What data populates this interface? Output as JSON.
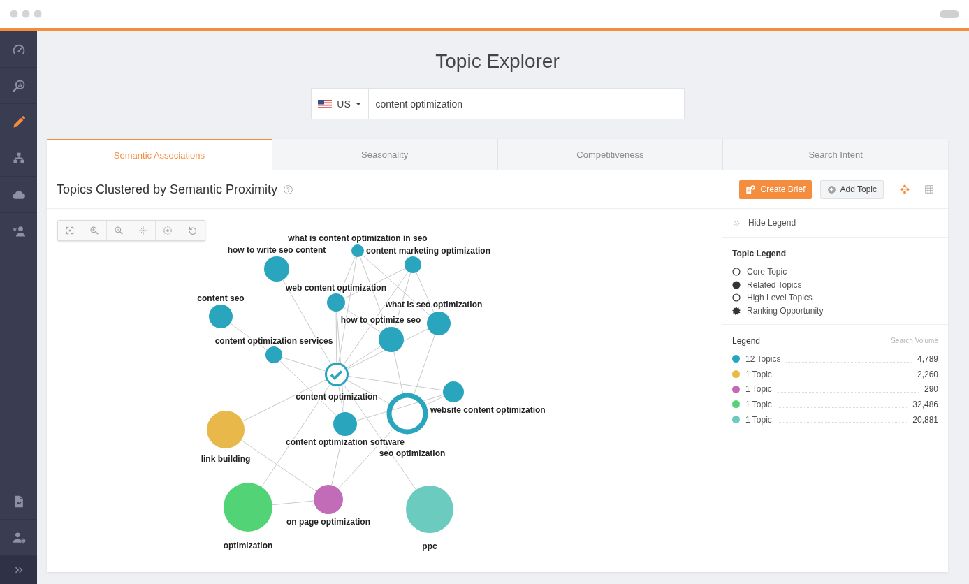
{
  "app": {
    "title": "Topic Explorer"
  },
  "sidebar": {
    "items": [
      {
        "selected": false
      },
      {
        "selected": false
      },
      {
        "selected": true
      },
      {
        "selected": false
      },
      {
        "selected": false
      },
      {
        "selected": false
      }
    ]
  },
  "search": {
    "country": "US",
    "value": "content optimization"
  },
  "tabs": [
    {
      "label": "Semantic Associations",
      "selected": true
    },
    {
      "label": "Seasonality",
      "selected": false
    },
    {
      "label": "Competitiveness",
      "selected": false
    },
    {
      "label": "Search Intent",
      "selected": false
    }
  ],
  "panel": {
    "title": "Topics Clustered by Semantic Proximity",
    "buttons": [
      {
        "label": "Create Brief",
        "kind": "primary"
      },
      {
        "label": "Add Topic",
        "kind": "secondary"
      }
    ],
    "view_toggles": [
      {
        "selected": true
      },
      {
        "selected": false
      }
    ]
  },
  "graph": {
    "nodes": [
      {
        "label": "what is content optimization in seo",
        "kind": "topic",
        "color": "#29a6bd"
      },
      {
        "label": "how to write seo content",
        "kind": "topic",
        "color": "#29a6bd"
      },
      {
        "label": "content marketing optimization",
        "kind": "topic",
        "color": "#29a6bd"
      },
      {
        "label": "web content optimization",
        "kind": "topic",
        "color": "#29a6bd"
      },
      {
        "label": "content seo",
        "kind": "topic",
        "color": "#29a6bd"
      },
      {
        "label": "what is seo optimization",
        "kind": "topic",
        "color": "#29a6bd"
      },
      {
        "label": "how to optimize seo",
        "kind": "topic",
        "color": "#29a6bd"
      },
      {
        "label": "content optimization services",
        "kind": "topic",
        "color": "#29a6bd"
      },
      {
        "label": "content optimization",
        "kind": "core",
        "color": "#29a6bd"
      },
      {
        "label": "website content optimization",
        "kind": "topic",
        "color": "#29a6bd"
      },
      {
        "label": "seo optimization",
        "kind": "high-level",
        "color": "#29a6bd"
      },
      {
        "label": "content optimization software",
        "kind": "topic",
        "color": "#29a6bd"
      },
      {
        "label": "link building",
        "kind": "topic",
        "color": "#e9b84a"
      },
      {
        "label": "on page optimization",
        "kind": "topic",
        "color": "#c26bb6"
      },
      {
        "label": "optimization",
        "kind": "topic",
        "color": "#52d376"
      },
      {
        "label": "ppc",
        "kind": "topic",
        "color": "#6ccbbf"
      }
    ]
  },
  "legend_panel": {
    "toggle": "Hide Legend",
    "topic_legend": {
      "title": "Topic Legend",
      "items": [
        {
          "label": "Core Topic",
          "kind": "open"
        },
        {
          "label": "Related Topics",
          "kind": "filled"
        },
        {
          "label": "High Level Topics",
          "kind": "open"
        },
        {
          "label": "Ranking Opportunity",
          "kind": "burst"
        }
      ]
    },
    "legend": {
      "title": "Legend",
      "column": "Search Volume",
      "items": [
        {
          "label": "12 Topics",
          "value": "4,789",
          "color": "#27a5bf"
        },
        {
          "label": "1 Topic",
          "value": "2,260",
          "color": "#e9b84a"
        },
        {
          "label": "1 Topic",
          "value": "290",
          "color": "#c26bb6"
        },
        {
          "label": "1 Topic",
          "value": "32,486",
          "color": "#52d376"
        },
        {
          "label": "1 Topic",
          "value": "20,881",
          "color": "#6ccbbf"
        }
      ]
    }
  }
}
